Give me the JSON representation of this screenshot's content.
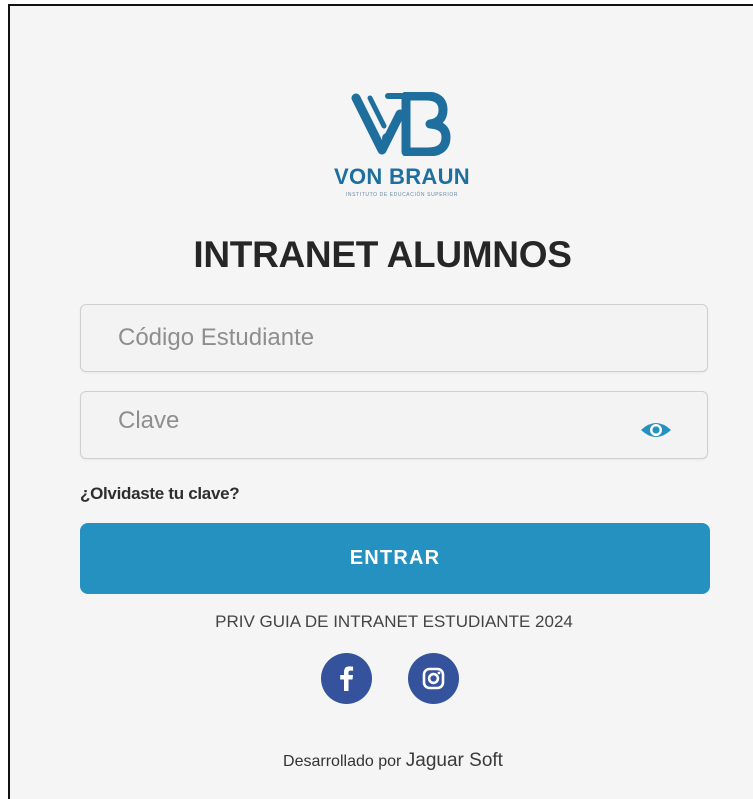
{
  "brand": {
    "name": "VON BRAUN",
    "subtitle": "INSTITUTO DE EDUCACIÓN SUPERIOR",
    "logo_icon": "vb-monogram-icon",
    "color": "#1f6f9e"
  },
  "page": {
    "title": "INTRANET ALUMNOS"
  },
  "form": {
    "code_placeholder": "Código Estudiante",
    "code_value": "",
    "password_placeholder": "Clave",
    "password_value": "",
    "password_toggle_icon": "eye-icon",
    "forgot_label": "¿Olvidaste tu clave?",
    "submit_label": "ENTRAR",
    "accent_color": "#2591c1"
  },
  "links": {
    "guide_label": "PRIV GUIA DE INTRANET ESTUDIANTE 2024"
  },
  "social": [
    {
      "network": "Facebook",
      "icon": "facebook-icon"
    },
    {
      "network": "Instagram",
      "icon": "instagram-icon"
    }
  ],
  "social_color": "#34539c",
  "footer": {
    "prefix": "Desarrollado por",
    "company": "Jaguar Soft"
  }
}
